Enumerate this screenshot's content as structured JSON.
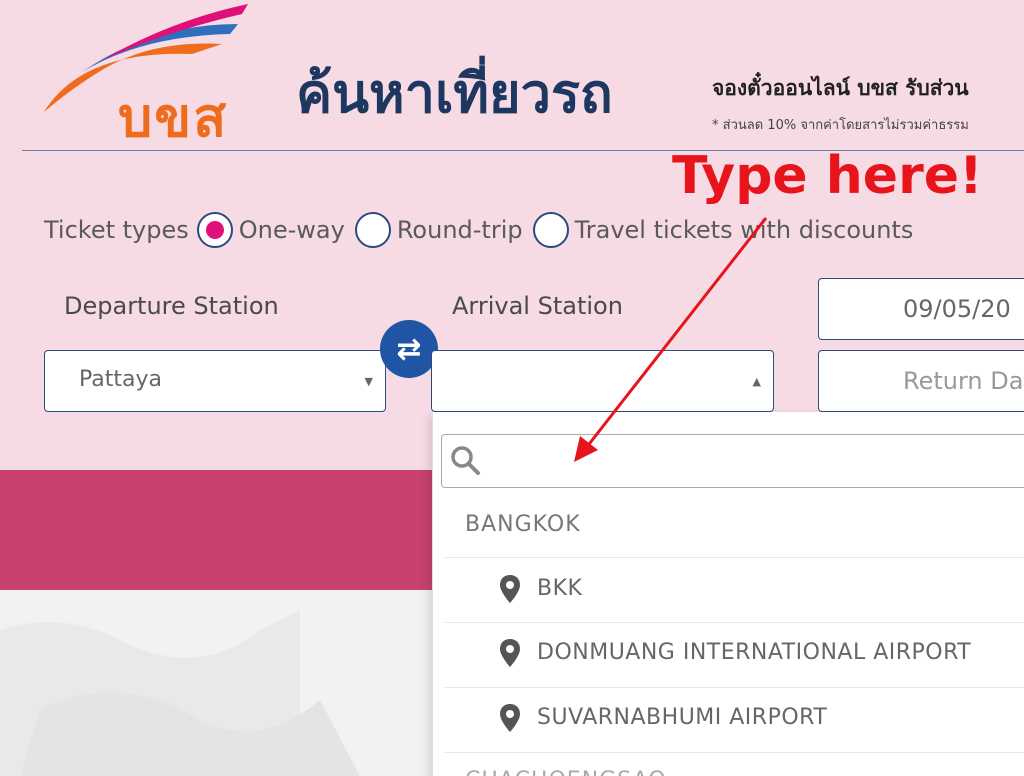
{
  "header": {
    "logo_text": "บขส",
    "title": "ค้นหาเที่ยวรถ",
    "tagline": "จองตั๋วออนไลน์ บขส รับส่วน",
    "tagline_note": "* ส่วนลด 10% จากค่าโดยสารไม่รวมค่าธรรม"
  },
  "ticket_types": {
    "label": "Ticket types",
    "options": [
      {
        "label": "One-way",
        "checked": true
      },
      {
        "label": "Round-trip",
        "checked": false
      },
      {
        "label": "Travel tickets with discounts",
        "checked": false
      }
    ]
  },
  "form": {
    "departure_label": "Departure Station",
    "departure_value": "Pattaya",
    "arrival_label": "Arrival Station",
    "arrival_value": "",
    "departure_date": "09/05/20",
    "return_date_placeholder": "Return Da",
    "swap_icon": "swap-arrows-icon"
  },
  "dropdown": {
    "search_placeholder": "",
    "group": "BANGKOK",
    "stations": [
      "BKK",
      "DONMUANG INTERNATIONAL AIRPORT",
      "SUVARNABHUMI AIRPORT"
    ],
    "next_group_partial": "CHACHOENGSAO"
  },
  "annotation": {
    "text": "Type here!",
    "color": "#e8141c"
  },
  "colors": {
    "page_bg": "#f6dbe4",
    "accent_magenta": "#e0107a",
    "band": "#c8426d",
    "swap_button": "#1f55a4",
    "border_navy": "#2c4a7c"
  }
}
